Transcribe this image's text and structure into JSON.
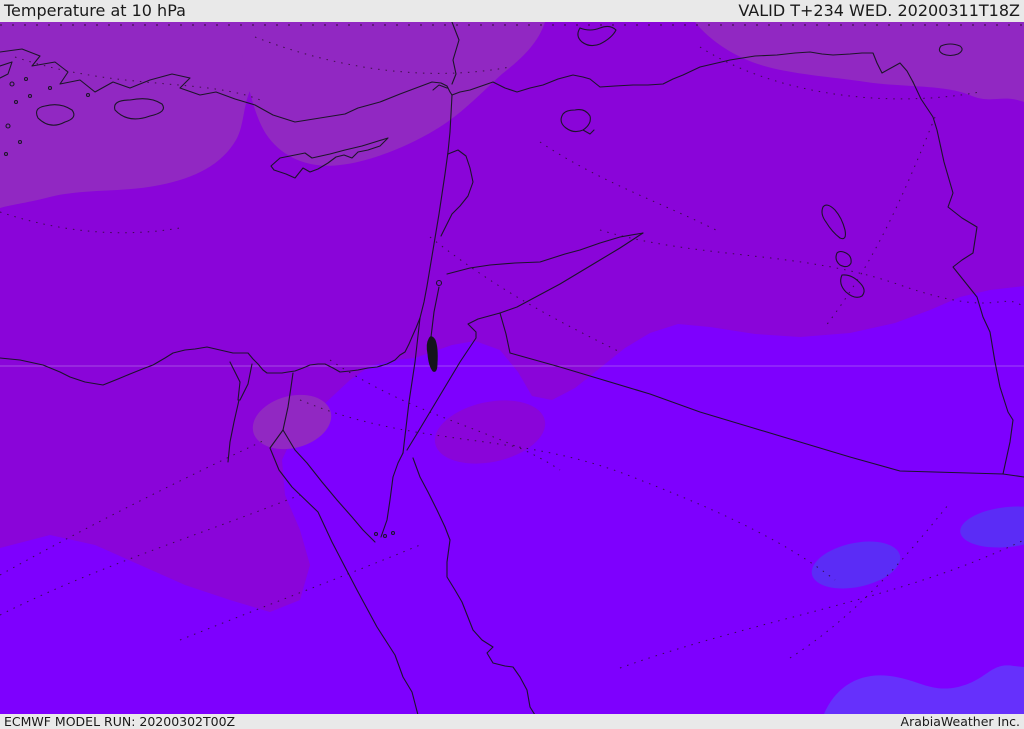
{
  "header": {
    "title": "Temperature at 10 hPa",
    "valid_label": "VALID T+234 WED. 20200311T18Z"
  },
  "footer": {
    "model_run": "ECMWF MODEL RUN: 20200302T00Z",
    "credit": "ArabiaWeather Inc."
  },
  "map": {
    "colors": {
      "medium_purple": "#8A05D9",
      "muted_purple": "#9128C2",
      "bright_violet": "#7E00FE",
      "cold_blue": "#5B2CF6",
      "cold_blue_band": "#6630FC",
      "outline": "#14141c",
      "contour": "#2a0a28",
      "gridline": "#C9A0F0",
      "bar_bg": "#e9e9e9",
      "bar_text": "#1a1a1a"
    }
  }
}
